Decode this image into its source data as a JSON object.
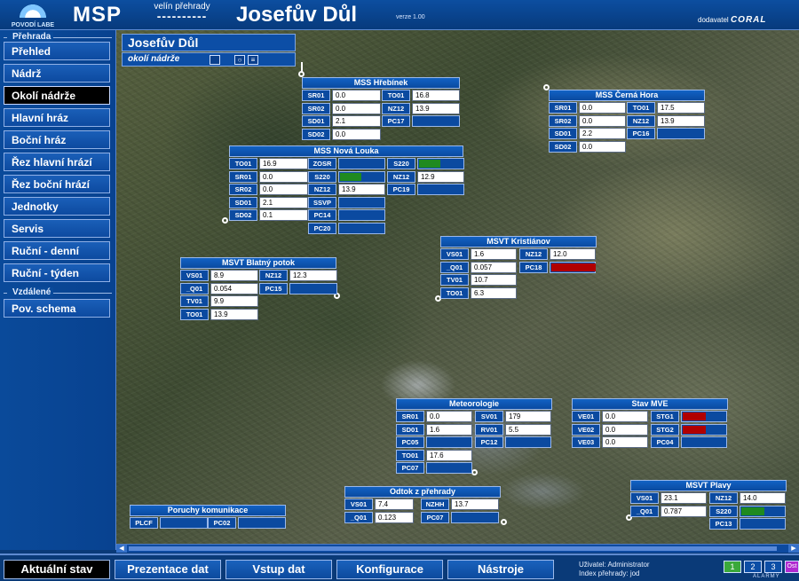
{
  "header": {
    "logo_text": "POVODÍ LABE",
    "app_name": "MSP",
    "subtitle": "velín přehrady",
    "dashes": "----------",
    "dam_name": "Josefův Důl",
    "version": "verze 1.00",
    "supplier_label": "dodavatel",
    "supplier_name": "CORAL"
  },
  "sidebar": {
    "group1": "Přehrada",
    "items": [
      "Přehled",
      "Nádrž",
      "Okolí nádrže",
      "Hlavní hráz",
      "Boční hráz",
      "Řez hlavní hrází",
      "Řez boční hrází",
      "Jednotky",
      "Servis",
      "Ruční - denní",
      "Ruční - týden"
    ],
    "active_index": 2,
    "group2": "Vzdálené",
    "items2": [
      "Pov. schema"
    ]
  },
  "location": {
    "title": "Josefův Důl",
    "subtitle": "okolí nádrže"
  },
  "panels": {
    "hrebinek": {
      "title": "MSS Hřebínek",
      "rows": [
        [
          "SR01",
          "0.0",
          "TO01",
          "16.8"
        ],
        [
          "SR02",
          "0.0",
          "NZ12",
          "13.9"
        ],
        [
          "SD01",
          "2.1",
          "PC17",
          ""
        ],
        [
          "SD02",
          "0.0"
        ]
      ]
    },
    "cerna_hora": {
      "title": "MSS Černá Hora",
      "rows": [
        [
          "SR01",
          "0.0",
          "TO01",
          "17.5"
        ],
        [
          "SR02",
          "0.0",
          "NZ12",
          "13.9"
        ],
        [
          "SD01",
          "2.2",
          "PC16",
          ""
        ],
        [
          "SD02",
          "0.0"
        ]
      ]
    },
    "nova_louka": {
      "title": "MSS Nová Louka",
      "col1": [
        [
          "TO01",
          "16.9"
        ],
        [
          "SR01",
          "0.0"
        ],
        [
          "SR02",
          "0.0"
        ],
        [
          "SD01",
          "2.1"
        ],
        [
          "SD02",
          "0.1"
        ]
      ],
      "col2": [
        [
          "ZOSR",
          ""
        ],
        [
          "S220",
          ""
        ],
        [
          "NZ12",
          "13.9"
        ],
        [
          "SSVP",
          ""
        ],
        [
          "PC14",
          ""
        ],
        [
          "PC20",
          ""
        ]
      ],
      "col3": [
        [
          "S220",
          ""
        ],
        [
          "NZ12",
          "12.9"
        ],
        [
          "PC19",
          ""
        ]
      ]
    },
    "kristianov": {
      "title": "MSVT Kristiánov",
      "col1": [
        [
          "VS01",
          "1.6"
        ],
        [
          "_Q01",
          "0.057"
        ],
        [
          "TV01",
          "10.7"
        ],
        [
          "TO01",
          "6.3"
        ]
      ],
      "col2": [
        [
          "NZ12",
          "12.0"
        ],
        [
          "PC18",
          ""
        ]
      ]
    },
    "blatny": {
      "title": "MSVT Blatný potok",
      "col1": [
        [
          "VS01",
          "8.9"
        ],
        [
          "_Q01",
          "0.054"
        ],
        [
          "TV01",
          "9.9"
        ],
        [
          "TO01",
          "13.9"
        ]
      ],
      "col2": [
        [
          "NZ12",
          "12.3"
        ],
        [
          "PC15",
          ""
        ]
      ]
    },
    "meteo": {
      "title": "Meteorologie",
      "col1": [
        [
          "SR01",
          "0.0"
        ],
        [
          "SD01",
          "1.6"
        ],
        [
          "PC05",
          ""
        ],
        [
          "TO01",
          "17.6"
        ],
        [
          "PC07",
          ""
        ]
      ],
      "col2": [
        [
          "SV01",
          "179"
        ],
        [
          "RV01",
          "5.5"
        ],
        [
          "PC12",
          ""
        ]
      ]
    },
    "mve": {
      "title": "Stav MVE",
      "col1": [
        [
          "VE01",
          "0.0"
        ],
        [
          "VE02",
          "0.0"
        ],
        [
          "VE03",
          "0.0"
        ]
      ],
      "col2": [
        [
          "STG1",
          ""
        ],
        [
          "STG2",
          ""
        ],
        [
          "PC04",
          ""
        ]
      ]
    },
    "odtok": {
      "title": "Odtok z přehrady",
      "col1": [
        [
          "VS01",
          "7.4"
        ],
        [
          "_Q01",
          "0.123"
        ]
      ],
      "col2": [
        [
          "NZHH",
          "13.7"
        ],
        [
          "PC07",
          ""
        ]
      ]
    },
    "plavy": {
      "title": "MSVT Plavy",
      "col1": [
        [
          "VS01",
          "23.1"
        ],
        [
          "_Q01",
          "0.787"
        ]
      ],
      "col2": [
        [
          "NZ12",
          "14.0"
        ],
        [
          "S220",
          ""
        ],
        [
          "PC13",
          ""
        ]
      ]
    },
    "poruchy": {
      "title": "Poruchy komunikace",
      "row": [
        [
          "PLCF",
          ""
        ],
        [
          "PC02",
          ""
        ]
      ]
    }
  },
  "bottom": {
    "buttons": [
      "Aktuální stav",
      "Prezentace dat",
      "Vstup dat",
      "Konfigurace",
      "Nástroje"
    ],
    "active_index": 0,
    "user_line": "Uživatel: Administrator",
    "index_line": "Index přehrady: jod",
    "alarm_buttons": [
      "1",
      "2",
      "3",
      "Ost"
    ],
    "alarm_label": "ALARMY"
  },
  "colors": {
    "green": "#1f8a1f",
    "red": "#b00000",
    "accent": "#0b4aa0"
  }
}
